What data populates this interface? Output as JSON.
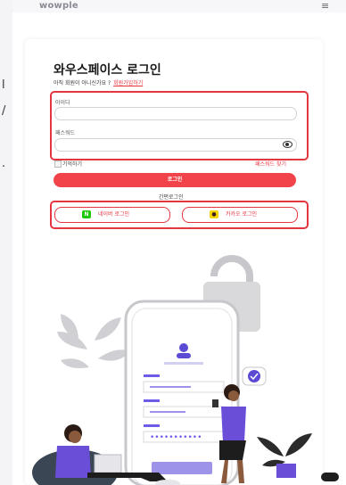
{
  "header": {
    "logo": "wowple",
    "menu_icon": "hamburger-icon"
  },
  "side_fragments": [
    "l",
    "/",
    "."
  ],
  "login": {
    "title": "와우스페이스 로그인",
    "signup_prompt": "아직 회원이 아니신가요 ?",
    "signup_link": "회원가입하기",
    "id_label": "아이디",
    "id_value": "",
    "password_label": "패스워드",
    "password_value": "",
    "remember_label": "기억하기",
    "find_password": "패스워드 찾기",
    "login_button": "로그인",
    "easy_login_label": "간편로그인",
    "naver_button": "네이버 로그인",
    "naver_icon_text": "N",
    "kakao_button": "카카오 로그인",
    "accent_color": "#f2434a"
  }
}
